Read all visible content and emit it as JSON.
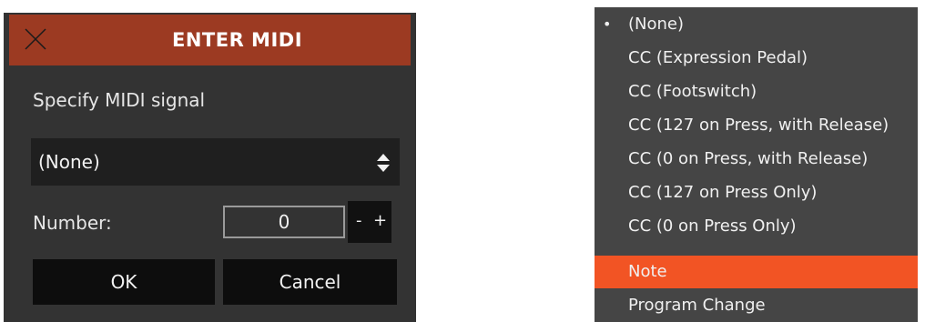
{
  "dialog": {
    "title": "ENTER MIDI",
    "prompt": "Specify MIDI signal",
    "signal_select": {
      "value": "(None)"
    },
    "number": {
      "label": "Number:",
      "value": "0",
      "decrement_label": "-",
      "increment_label": "+"
    },
    "ok_label": "OK",
    "cancel_label": "Cancel",
    "colors": {
      "background": "#333333",
      "header": "#9c3a22",
      "button": "#0d0d0d"
    }
  },
  "menu": {
    "items": [
      {
        "label": "(None)",
        "selected": true
      },
      {
        "label": "CC (Expression Pedal)"
      },
      {
        "label": "CC (Footswitch)"
      },
      {
        "label": "CC (127 on Press, with Release)"
      },
      {
        "label": "CC (0 on Press, with Release)"
      },
      {
        "label": "CC (127 on Press Only)"
      },
      {
        "label": "CC (0 on Press Only)"
      },
      {
        "label": "Note",
        "highlighted": true
      },
      {
        "label": "Program Change"
      }
    ],
    "selected_marker": "•",
    "colors": {
      "background": "#454545",
      "highlight": "#f25424"
    }
  }
}
